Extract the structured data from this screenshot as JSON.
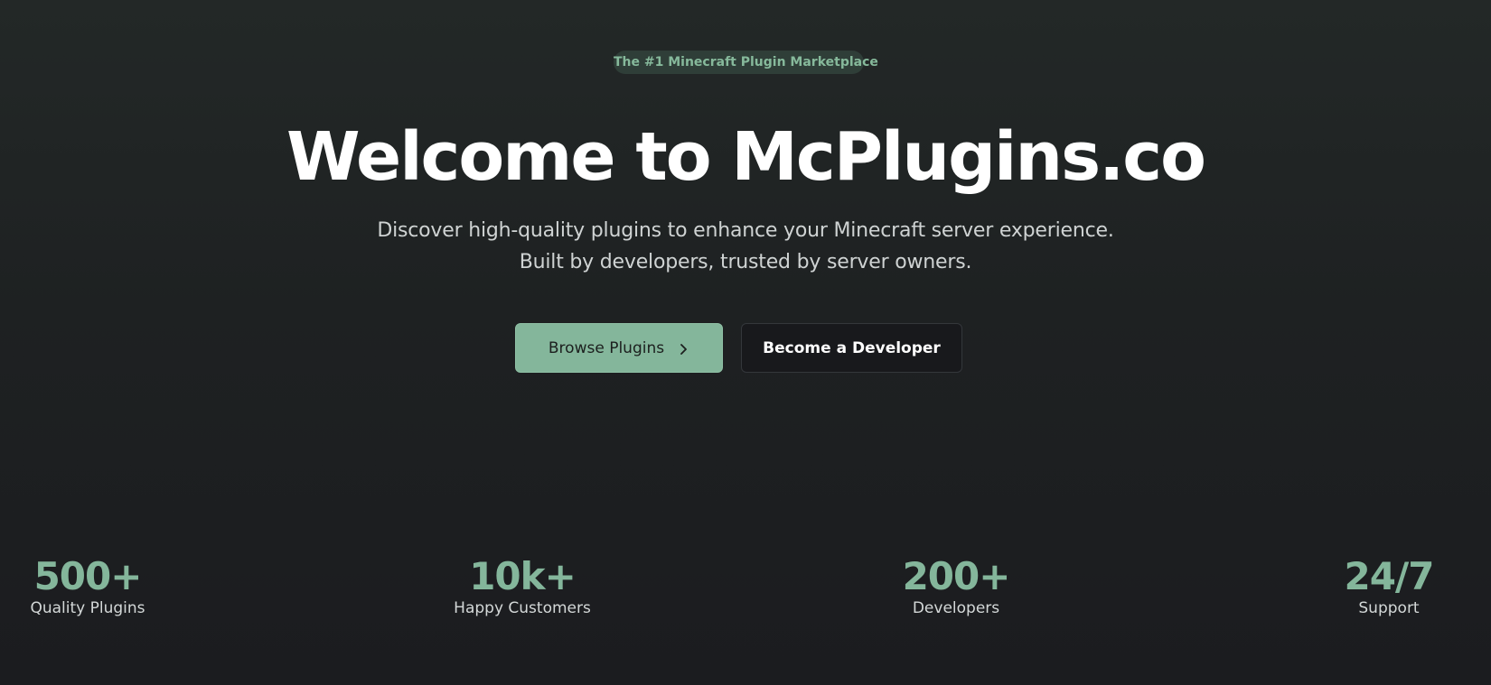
{
  "hero": {
    "badge": "The #1 Minecraft Plugin Marketplace",
    "title": "Welcome to McPlugins.co",
    "subtitle_line1": "Discover high-quality plugins to enhance your Minecraft server experience.",
    "subtitle_line2": "Built by developers, trusted by server owners.",
    "primary_button": "Browse Plugins",
    "secondary_button": "Become a Developer"
  },
  "stats": [
    {
      "value": "500+",
      "label": "Quality Plugins"
    },
    {
      "value": "10k+",
      "label": "Happy Customers"
    },
    {
      "value": "200+",
      "label": "Developers"
    },
    {
      "value": "24/7",
      "label": "Support"
    }
  ],
  "colors": {
    "accent": "#84b69b",
    "background": "#1e2122",
    "badge_bg": "#2f3e38",
    "secondary_button_bg": "#18191c"
  },
  "icons": {
    "primary_button_icon": "chevron-right-icon"
  }
}
